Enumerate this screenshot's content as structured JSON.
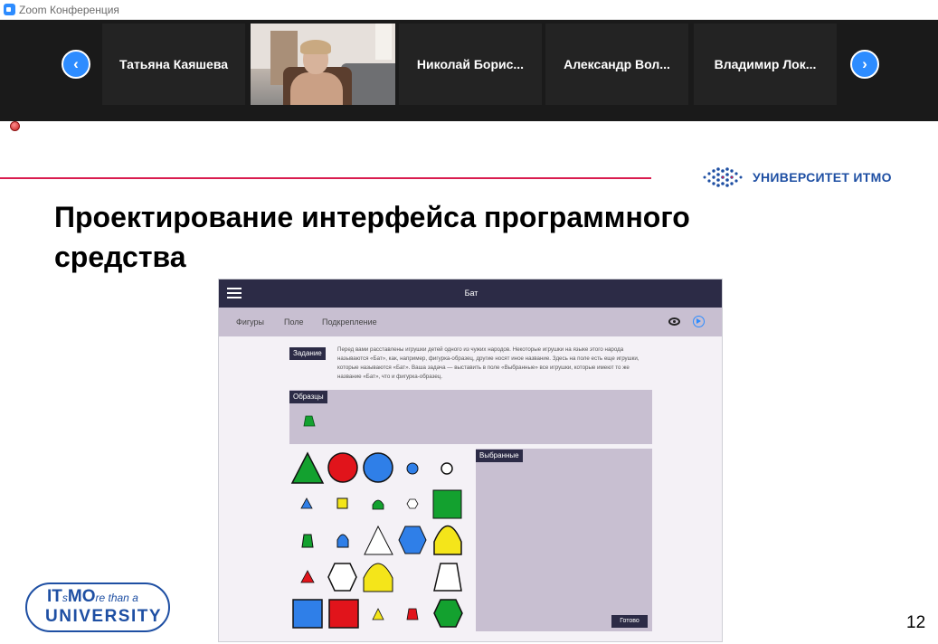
{
  "window": {
    "title": "Zoom Конференция"
  },
  "participants": {
    "prev_label": "‹",
    "next_label": "›",
    "tiles": [
      {
        "name": "Татьяна Каяшева"
      },
      {
        "name": "Николай Борис..."
      },
      {
        "name": "Александр Вол..."
      },
      {
        "name": "Владимир Лок..."
      }
    ]
  },
  "slide": {
    "brand": "УНИВЕРСИТЕТ ИТМО",
    "title": "Проектирование интерфейса программного средства",
    "page_number": "12",
    "badge_line1_a": "IT",
    "badge_line1_b": "s",
    "badge_line1_c": "MO",
    "badge_line1_tail": "re than a",
    "badge_line2": "UNIVERSITY"
  },
  "app": {
    "title": "Бат",
    "menu": [
      "Фигуры",
      "Поле",
      "Подкрепление"
    ],
    "task_label": "Задание",
    "task_text": "Перед вами расставлены игрушки детей одного из чужих народов. Некоторые игрушки на языке этого народа называются «Бат», как, например, фигурка-образец, другие носят иное название. Здесь на поле есть еще игрушки, которые называются «Бат». Ваша задача — выставить в поле «Выбранные» все игрушки, которые имеют то же название «Бат», что и фигурка-образец.",
    "samples_label": "Образцы",
    "selected_label": "Выбранные",
    "done_label": "Готово"
  },
  "colors": {
    "accent": "#d91c4f",
    "brand_blue": "#1e4fa3",
    "app_dark": "#2c2b46",
    "app_panel": "#c8bfd1",
    "green": "#13a12f",
    "red": "#e1141b",
    "blue": "#2f7fe8",
    "yellow": "#f4e51a"
  }
}
